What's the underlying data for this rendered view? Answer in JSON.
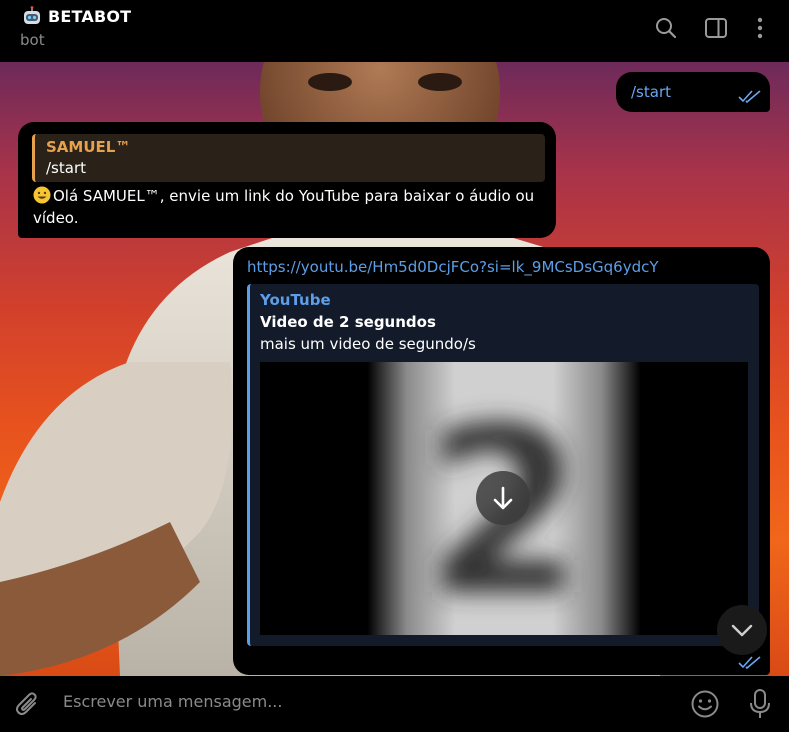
{
  "header": {
    "title": "BETABOT",
    "subtitle": "bot",
    "icons": [
      "robot-emoji",
      "search-icon",
      "sidebar-toggle-icon",
      "more-vertical-icon"
    ]
  },
  "messages": {
    "outgoing_start": {
      "text": "/start",
      "status": "read"
    },
    "incoming_reply": {
      "quote_author": "SAMUEL™",
      "quote_text": "/start",
      "emoji": "grinning-face",
      "text": "Olá SAMUEL™, envie um link do YouTube para baixar o áudio ou vídeo."
    },
    "outgoing_link": {
      "url": "https://youtu.be/Hm5d0DcjFCo?si=lk_9MCsDsGq6ydcY",
      "preview_site": "YouTube",
      "preview_title": "Video de 2 segundos",
      "preview_description": "mais um video de segundo/s",
      "status": "read"
    }
  },
  "composer": {
    "placeholder": "Escrever uma mensagem..."
  },
  "colors": {
    "link": "#5c9ee8",
    "quote_accent": "#e6a14e",
    "bubble": "#000000",
    "muted_text": "#8b8b8b"
  }
}
